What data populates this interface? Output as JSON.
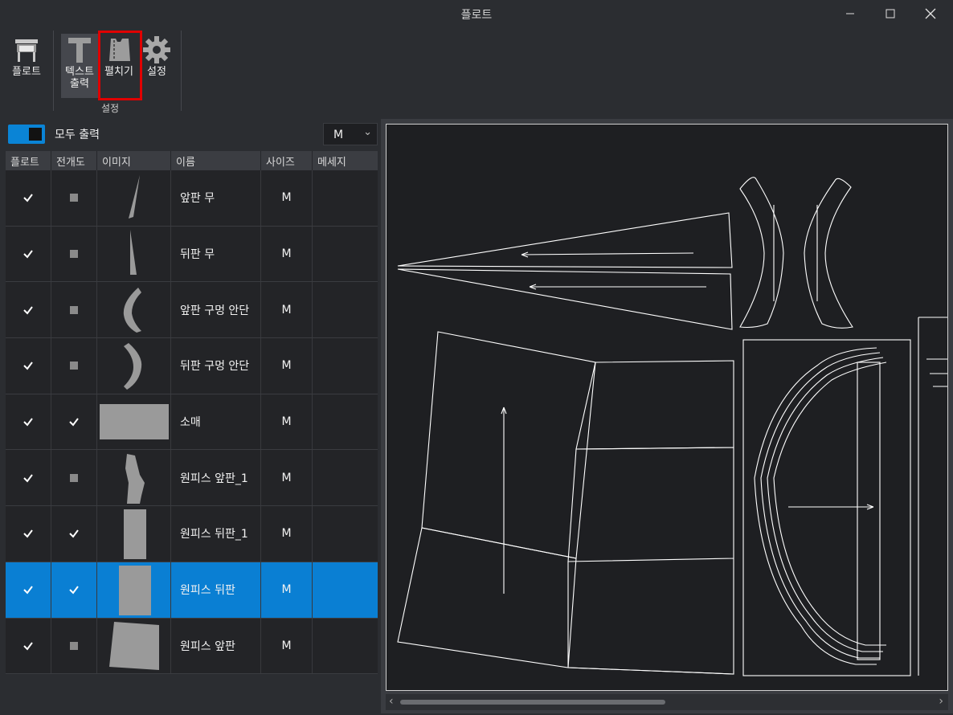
{
  "window": {
    "title": "플로트",
    "minimize_label": "—",
    "maximize_label": "☐",
    "close_label": "✕"
  },
  "toolbar": {
    "plot_label": "플로트",
    "text_output_label_1": "텍스트",
    "text_output_label_2": "출력",
    "unfold_label": "펼치기",
    "settings_label": "설정",
    "group_label": "설정"
  },
  "options": {
    "print_all_label": "모두 출력",
    "print_all_on": true,
    "size_value": "M",
    "size_chevron": "⌄"
  },
  "table": {
    "headers": [
      "플로트",
      "전개도",
      "이미지",
      "이름",
      "사이즈",
      "메세지"
    ],
    "rows": [
      {
        "plot": true,
        "unfold": false,
        "name": "앞판 무",
        "size": "M",
        "message": "",
        "selected": false
      },
      {
        "plot": true,
        "unfold": false,
        "name": "뒤판 무",
        "size": "M",
        "message": "",
        "selected": false
      },
      {
        "plot": true,
        "unfold": false,
        "name": "앞판 구멍 안단",
        "size": "M",
        "message": "",
        "selected": false
      },
      {
        "plot": true,
        "unfold": false,
        "name": "뒤판 구멍 안단",
        "size": "M",
        "message": "",
        "selected": false
      },
      {
        "plot": true,
        "unfold": true,
        "name": "소매",
        "size": "M",
        "message": "",
        "selected": false
      },
      {
        "plot": true,
        "unfold": false,
        "name": "원피스 앞판_1",
        "size": "M",
        "message": "",
        "selected": false
      },
      {
        "plot": true,
        "unfold": true,
        "name": "원피스 뒤판_1",
        "size": "M",
        "message": "",
        "selected": false
      },
      {
        "plot": true,
        "unfold": true,
        "name": "원피스 뒤판",
        "size": "M",
        "message": "",
        "selected": true
      },
      {
        "plot": true,
        "unfold": false,
        "name": "원피스 앞판",
        "size": "M",
        "message": "",
        "selected": false
      }
    ]
  },
  "colors": {
    "accent": "#0a7fd3",
    "highlight_box": "#e00000",
    "canvas_bg": "#1e1f22",
    "pattern_line": "#ffffff"
  }
}
